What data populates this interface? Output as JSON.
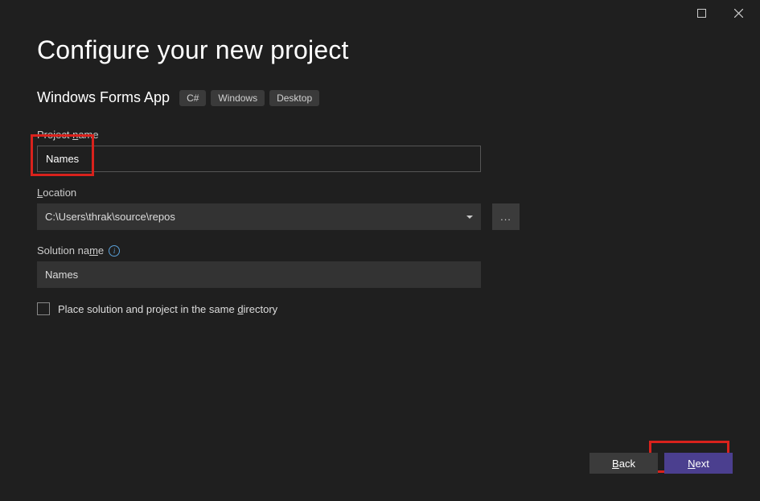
{
  "titlebar": {
    "maximize_icon": "maximize",
    "close_icon": "close"
  },
  "header": {
    "title": "Configure your new project",
    "template_name": "Windows Forms App",
    "tags": [
      "C#",
      "Windows",
      "Desktop"
    ]
  },
  "fields": {
    "project_name": {
      "label_pre": "Project ",
      "label_u": "n",
      "label_post": "ame",
      "value": "Names"
    },
    "location": {
      "label_u": "L",
      "label_post": "ocation",
      "value": "C:\\Users\\thrak\\source\\repos",
      "browse": "..."
    },
    "solution_name": {
      "label_pre": "Solution na",
      "label_u": "m",
      "label_post": "e",
      "value": "Names"
    },
    "same_dir": {
      "label_pre": "Place solution and project in the same ",
      "label_u": "d",
      "label_post": "irectory"
    }
  },
  "buttons": {
    "back_u": "B",
    "back_post": "ack",
    "next_u": "N",
    "next_post": "ext"
  }
}
